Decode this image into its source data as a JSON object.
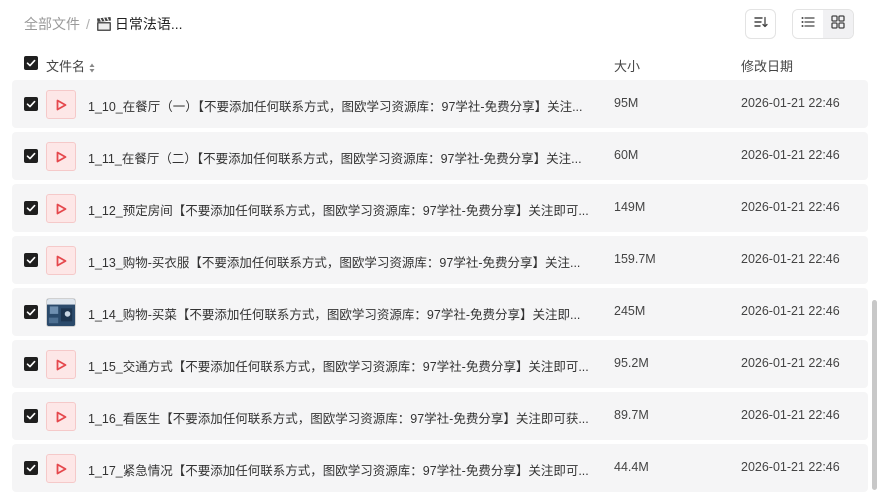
{
  "breadcrumb": {
    "root": "全部文件",
    "separator": "/",
    "current": "日常法语..."
  },
  "toolbar": {
    "sort_icon": "sort-icon",
    "list_view_icon": "list-view-icon",
    "grid_view_icon": "grid-view-icon"
  },
  "columns": {
    "name": "文件名",
    "size": "大小",
    "modified": "修改日期"
  },
  "files": [
    {
      "name": "1_10_在餐厅（一）【不要添加任何联系方式，图欧学习资源库：97学社-免费分享】关注...",
      "size": "95M",
      "date": "2026-01-21 22:46",
      "type": "video"
    },
    {
      "name": "1_11_在餐厅（二）【不要添加任何联系方式，图欧学习资源库：97学社-免费分享】关注...",
      "size": "60M",
      "date": "2026-01-21 22:46",
      "type": "video"
    },
    {
      "name": "1_12_预定房间【不要添加任何联系方式，图欧学习资源库：97学社-免费分享】关注即可...",
      "size": "149M",
      "date": "2026-01-21 22:46",
      "type": "video"
    },
    {
      "name": "1_13_购物-买衣服【不要添加任何联系方式，图欧学习资源库：97学社-免费分享】关注...",
      "size": "159.7M",
      "date": "2026-01-21 22:46",
      "type": "video"
    },
    {
      "name": "1_14_购物-买菜【不要添加任何联系方式，图欧学习资源库：97学社-免费分享】关注即...",
      "size": "245M",
      "date": "2026-01-21 22:46",
      "type": "thumbnail"
    },
    {
      "name": "1_15_交通方式【不要添加任何联系方式，图欧学习资源库：97学社-免费分享】关注即可...",
      "size": "95.2M",
      "date": "2026-01-21 22:46",
      "type": "video"
    },
    {
      "name": "1_16_看医生【不要添加任何联系方式，图欧学习资源库：97学社-免费分享】关注即可获...",
      "size": "89.7M",
      "date": "2026-01-21 22:46",
      "type": "video"
    },
    {
      "name": "1_17_紧急情况【不要添加任何联系方式，图欧学习资源库：97学社-免费分享】关注即可...",
      "size": "44.4M",
      "date": "2026-01-21 22:46",
      "type": "video"
    }
  ],
  "colors": {
    "row_bg": "#f5f5f6",
    "video_icon": "#e5484d",
    "checkbox": "#1f1f1f"
  }
}
